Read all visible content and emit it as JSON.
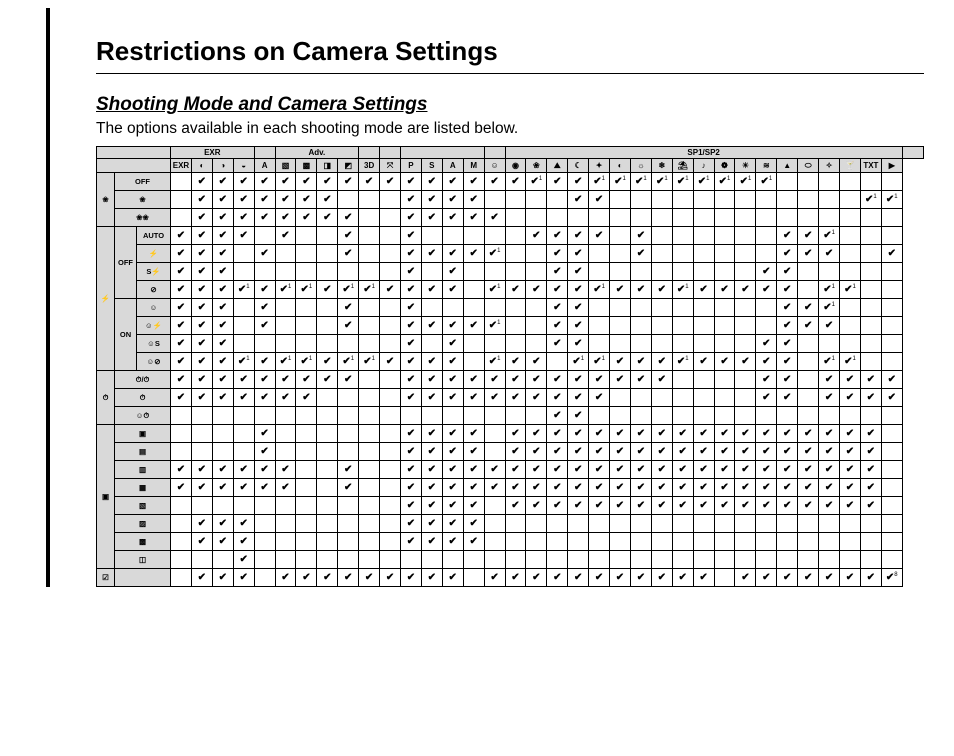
{
  "title": "Restrictions on Camera Settings",
  "subtitle": "Shooting Mode and Camera Settings",
  "description": "The options available in each shooting mode are listed below.",
  "column_groups": [
    {
      "label": "EXR",
      "span": 4
    },
    {
      "label": "",
      "span": 1
    },
    {
      "label": "Adv.",
      "span": 4
    },
    {
      "label": "",
      "span": 1
    },
    {
      "label": "",
      "span": 1
    },
    {
      "label": "",
      "span": 4
    },
    {
      "label": "",
      "span": 1
    },
    {
      "label": "SP1/SP2",
      "span": 19
    },
    {
      "label": "",
      "span": 1
    }
  ],
  "columns": [
    "EXR",
    "R1",
    "R2",
    "R3",
    "A",
    "Adv1",
    "Adv2",
    "Adv3",
    "Adv4",
    "3D",
    "PANO",
    "P",
    "S",
    "A",
    "M",
    "F1",
    "F2",
    "F3",
    "F4",
    "F5",
    "F6",
    "F7",
    "F8",
    "F9",
    "F10",
    "F11",
    "F12",
    "F13",
    "F14",
    "F15",
    "F16",
    "F17",
    "F18",
    "TXT",
    "MV"
  ],
  "row_groups": [
    {
      "icon": "macro",
      "sub": null,
      "rows": [
        {
          "label": "OFF",
          "cells": [
            "",
            "✔",
            "✔",
            "✔",
            "✔",
            "✔",
            "✔",
            "✔",
            "✔",
            "✔",
            "✔",
            "✔",
            "✔",
            "✔",
            "✔",
            "✔",
            "✔",
            "✔1",
            "✔",
            "✔",
            "✔1",
            "✔1",
            "✔1",
            "✔1",
            "✔1",
            "✔1",
            "✔1",
            "✔1",
            "✔1",
            "",
            "",
            "",
            "",
            "",
            ""
          ]
        },
        {
          "label": "flwr",
          "cells": [
            "",
            "✔",
            "✔",
            "✔",
            "✔",
            "✔",
            "✔",
            "✔",
            "",
            "",
            "",
            "✔",
            "✔",
            "✔",
            "✔",
            "",
            "",
            "",
            "",
            "✔",
            "✔",
            "",
            "",
            "",
            "",
            "",
            "",
            "",
            "",
            "",
            "",
            "",
            "",
            "✔1",
            "✔1"
          ]
        },
        {
          "label": "sup",
          "cells": [
            "",
            "✔",
            "✔",
            "✔",
            "✔",
            "✔",
            "✔",
            "✔",
            "✔",
            "",
            "",
            "✔",
            "✔",
            "✔",
            "✔",
            "✔",
            "",
            "",
            "",
            "",
            "",
            "",
            "",
            "",
            "",
            "",
            "",
            "",
            "",
            "",
            "",
            "",
            "",
            "",
            ""
          ]
        }
      ]
    },
    {
      "icon": "flash",
      "sub": [
        {
          "label": "OFF",
          "rows": [
            {
              "label": "AUTO",
              "cells": [
                "✔",
                "✔",
                "✔",
                "✔",
                "",
                "✔",
                "",
                "",
                "✔",
                "",
                "",
                "✔",
                "",
                "",
                "",
                "",
                "",
                "✔",
                "✔",
                "✔",
                "✔",
                "",
                "✔",
                "",
                "",
                "",
                "",
                "",
                "",
                "✔",
                "✔",
                "✔1",
                "",
                "",
                ""
              ]
            },
            {
              "label": "fill",
              "cells": [
                "✔",
                "✔",
                "✔",
                "",
                "✔",
                "",
                "",
                "",
                "✔",
                "",
                "",
                "✔",
                "✔",
                "✔",
                "✔",
                "✔1",
                "",
                "",
                "✔",
                "✔",
                "",
                "",
                "✔",
                "",
                "",
                "",
                "",
                "",
                "",
                "✔",
                "✔",
                "✔",
                "",
                "",
                "✔"
              ]
            },
            {
              "label": "slow",
              "cells": [
                "✔",
                "✔",
                "✔",
                "",
                "",
                "",
                "",
                "",
                "",
                "",
                "",
                "✔",
                "",
                "✔",
                "",
                "",
                "",
                "",
                "✔",
                "✔",
                "",
                "",
                "",
                "",
                "",
                "",
                "",
                "",
                "✔",
                "✔",
                "",
                "",
                "",
                "",
                ""
              ]
            },
            {
              "label": "off",
              "cells": [
                "✔",
                "✔",
                "✔",
                "✔1",
                "✔",
                "✔1",
                "✔1",
                "✔",
                "✔1",
                "✔1",
                "✔",
                "✔",
                "✔",
                "✔",
                "",
                "✔1",
                "✔",
                "✔",
                "✔",
                "✔",
                "✔1",
                "✔",
                "✔",
                "✔",
                "✔1",
                "✔",
                "✔",
                "✔",
                "✔",
                "✔",
                "",
                "✔1",
                "✔1",
                "",
                ""
              ]
            }
          ]
        },
        {
          "label": "ON",
          "rows": [
            {
              "label": "re1",
              "cells": [
                "✔",
                "✔",
                "✔",
                "",
                "✔",
                "",
                "",
                "",
                "✔",
                "",
                "",
                "✔",
                "",
                "",
                "",
                "",
                "",
                "",
                "✔",
                "✔",
                "",
                "",
                "",
                "",
                "",
                "",
                "",
                "",
                "",
                "✔",
                "✔",
                "✔1",
                "",
                "",
                ""
              ]
            },
            {
              "label": "re2",
              "cells": [
                "✔",
                "✔",
                "✔",
                "",
                "✔",
                "",
                "",
                "",
                "✔",
                "",
                "",
                "✔",
                "✔",
                "✔",
                "✔",
                "✔1",
                "",
                "",
                "✔",
                "✔",
                "",
                "",
                "",
                "",
                "",
                "",
                "",
                "",
                "",
                "✔",
                "✔",
                "✔",
                "",
                "",
                ""
              ]
            },
            {
              "label": "re3",
              "cells": [
                "✔",
                "✔",
                "✔",
                "",
                "",
                "",
                "",
                "",
                "",
                "",
                "",
                "✔",
                "",
                "✔",
                "",
                "",
                "",
                "",
                "✔",
                "✔",
                "",
                "",
                "",
                "",
                "",
                "",
                "",
                "",
                "✔",
                "✔",
                "",
                "",
                "",
                "",
                ""
              ]
            },
            {
              "label": "re4",
              "cells": [
                "✔",
                "✔",
                "✔",
                "✔1",
                "✔",
                "✔1",
                "✔1",
                "✔",
                "✔1",
                "✔1",
                "✔",
                "✔",
                "✔",
                "✔",
                "",
                "✔1",
                "✔",
                "✔",
                "",
                "✔1",
                "✔1",
                "✔",
                "✔",
                "✔",
                "✔1",
                "✔",
                "✔",
                "✔",
                "✔",
                "✔",
                "",
                "✔1",
                "✔1",
                "",
                ""
              ]
            }
          ]
        }
      ]
    },
    {
      "icon": "timer",
      "sub": null,
      "rows": [
        {
          "label": "t1",
          "cells": [
            "✔",
            "✔",
            "✔",
            "✔",
            "✔",
            "✔",
            "✔",
            "✔",
            "✔",
            "",
            "",
            "✔",
            "✔",
            "✔",
            "✔",
            "✔",
            "✔",
            "✔",
            "✔",
            "✔",
            "✔",
            "✔",
            "✔",
            "✔",
            "",
            "",
            "",
            "",
            "✔",
            "✔",
            "",
            "✔",
            "✔",
            "✔",
            "✔"
          ]
        },
        {
          "label": "t2",
          "cells": [
            "✔",
            "✔",
            "✔",
            "✔",
            "✔",
            "✔",
            "✔",
            "",
            "",
            "",
            "",
            "✔",
            "✔",
            "✔",
            "✔",
            "✔",
            "✔",
            "✔",
            "✔",
            "✔",
            "✔",
            "",
            "",
            "",
            "",
            "",
            "",
            "",
            "✔",
            "✔",
            "",
            "✔",
            "✔",
            "✔",
            "✔"
          ]
        },
        {
          "label": "t3",
          "cells": [
            "",
            "",
            "",
            "",
            "",
            "",
            "",
            "",
            "",
            "",
            "",
            "",
            "",
            "",
            "",
            "",
            "",
            "",
            "✔",
            "✔",
            "",
            "",
            "",
            "",
            "",
            "",
            "",
            "",
            "",
            "",
            "",
            "",
            "",
            "",
            ""
          ]
        }
      ]
    },
    {
      "icon": "drive",
      "sub": null,
      "rows": [
        {
          "label": "d1",
          "cells": [
            "",
            "",
            "",
            "",
            "✔",
            "",
            "",
            "",
            "",
            "",
            "",
            "✔",
            "✔",
            "✔",
            "✔",
            "",
            "✔",
            "✔",
            "✔",
            "✔",
            "✔",
            "✔",
            "✔",
            "✔",
            "✔",
            "✔",
            "✔",
            "✔",
            "✔",
            "✔",
            "✔",
            "✔",
            "✔",
            "✔",
            ""
          ]
        },
        {
          "label": "d2",
          "cells": [
            "",
            "",
            "",
            "",
            "✔",
            "",
            "",
            "",
            "",
            "",
            "",
            "✔",
            "✔",
            "✔",
            "✔",
            "",
            "✔",
            "✔",
            "✔",
            "✔",
            "✔",
            "✔",
            "✔",
            "✔",
            "✔",
            "✔",
            "✔",
            "✔",
            "✔",
            "✔",
            "✔",
            "✔",
            "✔",
            "✔",
            ""
          ]
        },
        {
          "label": "d3",
          "cells": [
            "✔",
            "✔",
            "✔",
            "✔",
            "✔",
            "✔",
            "",
            "",
            "✔",
            "",
            "",
            "✔",
            "✔",
            "✔",
            "✔",
            "✔",
            "✔",
            "✔",
            "✔",
            "✔",
            "✔",
            "✔",
            "✔",
            "✔",
            "✔",
            "✔",
            "✔",
            "✔",
            "✔",
            "✔",
            "✔",
            "✔",
            "✔",
            "✔",
            ""
          ]
        },
        {
          "label": "d4",
          "cells": [
            "✔",
            "✔",
            "✔",
            "✔",
            "✔",
            "✔",
            "",
            "",
            "✔",
            "",
            "",
            "✔",
            "✔",
            "✔",
            "✔",
            "✔",
            "✔",
            "✔",
            "✔",
            "✔",
            "✔",
            "✔",
            "✔",
            "✔",
            "✔",
            "✔",
            "✔",
            "✔",
            "✔",
            "✔",
            "✔",
            "✔",
            "✔",
            "✔",
            ""
          ]
        },
        {
          "label": "d5",
          "cells": [
            "",
            "",
            "",
            "",
            "",
            "",
            "",
            "",
            "",
            "",
            "",
            "✔",
            "✔",
            "✔",
            "✔",
            "",
            "✔",
            "✔",
            "✔",
            "✔",
            "✔",
            "✔",
            "✔",
            "✔",
            "✔",
            "✔",
            "✔",
            "✔",
            "✔",
            "✔",
            "✔",
            "✔",
            "✔",
            "✔",
            ""
          ]
        },
        {
          "label": "d6",
          "cells": [
            "",
            "✔",
            "✔",
            "✔",
            "",
            "",
            "",
            "",
            "",
            "",
            "",
            "✔",
            "✔",
            "✔",
            "✔",
            "",
            "",
            "",
            "",
            "",
            "",
            "",
            "",
            "",
            "",
            "",
            "",
            "",
            "",
            "",
            "",
            "",
            "",
            "",
            ""
          ]
        },
        {
          "label": "d7",
          "cells": [
            "",
            "✔",
            "✔",
            "✔",
            "",
            "",
            "",
            "",
            "",
            "",
            "",
            "✔",
            "✔",
            "✔",
            "✔",
            "",
            "",
            "",
            "",
            "",
            "",
            "",
            "",
            "",
            "",
            "",
            "",
            "",
            "",
            "",
            "",
            "",
            "",
            "",
            ""
          ]
        },
        {
          "label": "d8",
          "cells": [
            "",
            "",
            "",
            "✔",
            "",
            "",
            "",
            "",
            "",
            "",
            "",
            "",
            "",
            "",
            "",
            "",
            "",
            "",
            "",
            "",
            "",
            "",
            "",
            "",
            "",
            "",
            "",
            "",
            "",
            "",
            "",
            "",
            "",
            "",
            ""
          ]
        }
      ]
    },
    {
      "icon": "exp",
      "sub": null,
      "rows": [
        {
          "label": "",
          "cells": [
            "",
            "✔",
            "✔",
            "✔",
            "",
            "✔",
            "✔",
            "✔",
            "✔",
            "✔",
            "✔",
            "✔",
            "✔",
            "✔",
            "",
            "✔",
            "✔",
            "✔",
            "✔",
            "✔",
            "✔",
            "✔",
            "✔",
            "✔",
            "✔",
            "✔",
            "",
            "✔",
            "✔",
            "✔",
            "✔",
            "✔",
            "✔",
            "✔",
            "✔8"
          ]
        }
      ]
    }
  ]
}
